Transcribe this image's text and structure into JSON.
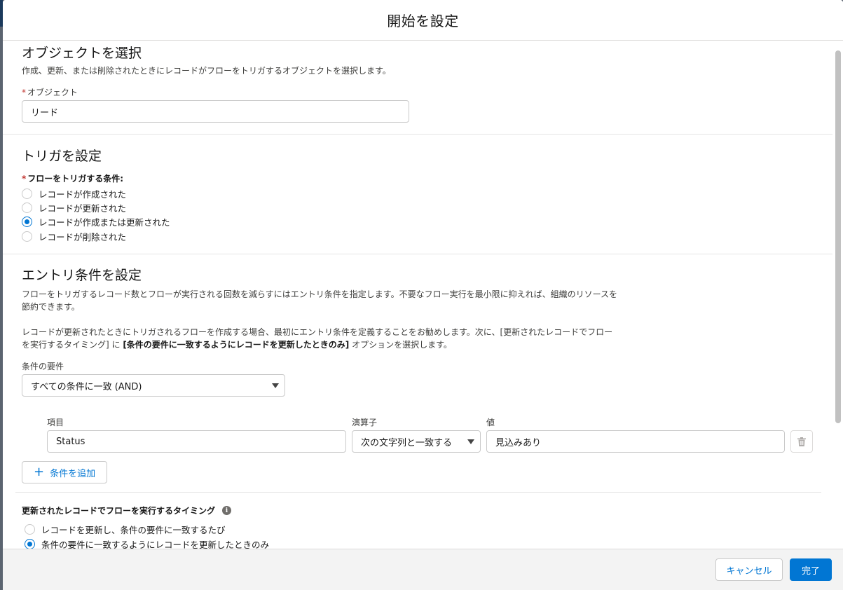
{
  "modal": {
    "title": "開始を設定"
  },
  "object_section": {
    "heading": "オブジェクトを選択",
    "description": "作成、更新、または削除されたときにレコードがフローをトリガするオブジェクトを選択します。",
    "field_label": "オブジェクト",
    "required_mark": "*",
    "field_value": "リード"
  },
  "trigger_section": {
    "heading": "トリガを設定",
    "field_label": "フローをトリガする条件:",
    "required_mark": "*",
    "options": [
      {
        "label": "レコードが作成された",
        "checked": false
      },
      {
        "label": "レコードが更新された",
        "checked": false
      },
      {
        "label": "レコードが作成または更新された",
        "checked": true
      },
      {
        "label": "レコードが削除された",
        "checked": false
      }
    ]
  },
  "entry_section": {
    "heading": "エントリ条件を設定",
    "desc1_line1": "フローをトリガするレコード数とフローが実行される回数を減らすにはエントリ条件を指定します。不要なフロー実行を最小限に抑えれば、組織のリソースを",
    "desc1_line2": "節約できます。",
    "desc2_line1": "レコードが更新されたときにトリガされるフローを作成する場合、最初にエントリ条件を定義することをお勧めします。次に、[更新されたレコードでフロー",
    "desc2_line2_a": "を実行するタイミング] に ",
    "desc2_line2_b": "[条件の要件に一致するようにレコードを更新したときのみ]",
    "desc2_line2_c": " オプションを選択します。",
    "requirement_label": "条件の要件",
    "requirement_value": "すべての条件に一致 (AND)",
    "condition": {
      "field_header": "項目",
      "operator_header": "演算子",
      "value_header": "値",
      "field_value": "Status",
      "operator_value": "次の文字列と一致する",
      "value_value": "見込みあり"
    },
    "add_condition_label": "条件を追加"
  },
  "timing_section": {
    "heading": "更新されたレコードでフローを実行するタイミング",
    "options": [
      {
        "label": "レコードを更新し、条件の要件に一致するたび",
        "checked": false
      },
      {
        "label": "条件の要件に一致するようにレコードを更新したときのみ",
        "checked": true
      }
    ]
  },
  "footer": {
    "cancel_label": "キャンセル",
    "done_label": "完了"
  },
  "colors": {
    "brand": "#0176d3",
    "required": "#c23934"
  }
}
